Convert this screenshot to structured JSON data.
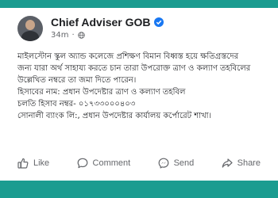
{
  "post": {
    "author": "Chief Adviser GOB",
    "time": "34m",
    "separator": "·",
    "lines": [
      "মাইলস্টোন স্কুল অ্যান্ড কলেজে প্রশিক্ষণ বিমান বিধ্বস্ত হয়ে ক্ষতিগ্রস্তদের",
      "জন্য যারা অর্থ সাহায্য করতে চান তারা উপরোক্ত ত্রাণ ও কল্যাণ তহবিলের",
      "উল্লেখিত নম্বরে তা জমা দিতে পারেন।",
      "হিসাবের নাম: প্রধান উপদেষ্টার ত্রাণ ও কল্যাণ তহবিল",
      "চলতি হিসাব নম্বর- ০১৭৩৩০০০৪০৩",
      "সোনালী ব্যাংক লি:, প্রধান উপদেষ্টার কার্যালয় কর্পোরেট শাখা।"
    ]
  },
  "actions": {
    "like": "Like",
    "comment": "Comment",
    "send": "Send",
    "share": "Share"
  },
  "colors": {
    "frame": "#1b9c90",
    "verified": "#1877f2",
    "text": "#1c1e21",
    "muted": "#65676b"
  }
}
